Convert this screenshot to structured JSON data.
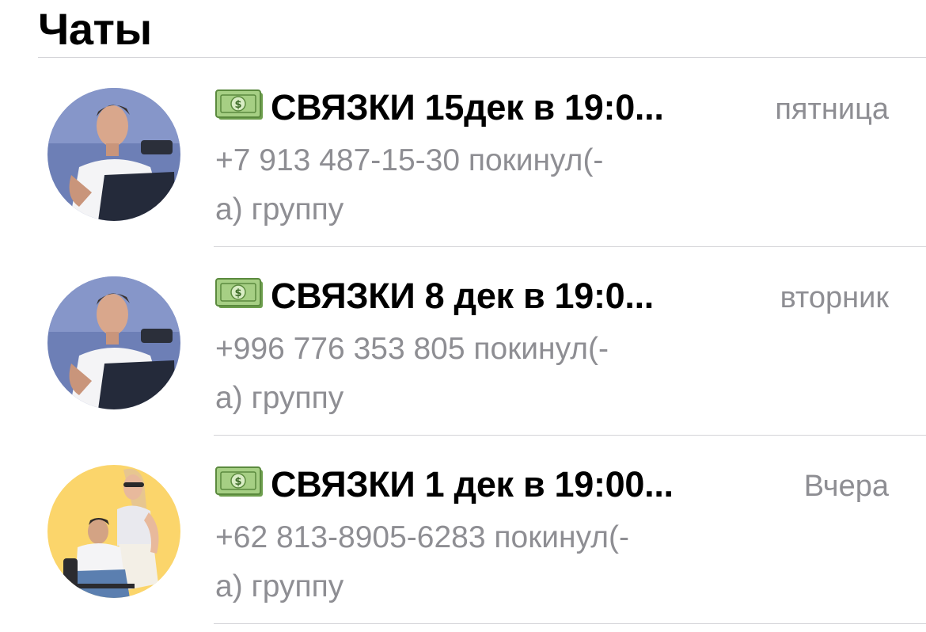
{
  "header": {
    "title": "Чаты"
  },
  "chats": [
    {
      "avatar": "man-with-laptop-avatar",
      "title": "СВЯЗКИ 15дек в 19:0...",
      "title_icon": "money-banknote-icon",
      "date": "пятница",
      "preview_line1": "+7 913 487-15-30 покинул(-",
      "preview_line2": "а) группу"
    },
    {
      "avatar": "man-with-laptop-avatar",
      "title": "СВЯЗКИ 8 дек в 19:0...",
      "title_icon": "money-banknote-icon",
      "date": "вторник",
      "preview_line1": "+996 776 353 805 покинул(-",
      "preview_line2": "а) группу"
    },
    {
      "avatar": "couple-yellow-background-avatar",
      "title": "СВЯЗКИ 1 дек в 19:00...",
      "title_icon": "money-banknote-icon",
      "date": "Вчера",
      "preview_line1": "+62 813-8905-6283 покинул(-",
      "preview_line2": "а) группу"
    }
  ],
  "colors": {
    "secondary_text": "#8e8e93",
    "divider": "#d4d4d8",
    "money_green": "#8fbf6a",
    "avatar_yellow_bg": "#fbd56b"
  }
}
